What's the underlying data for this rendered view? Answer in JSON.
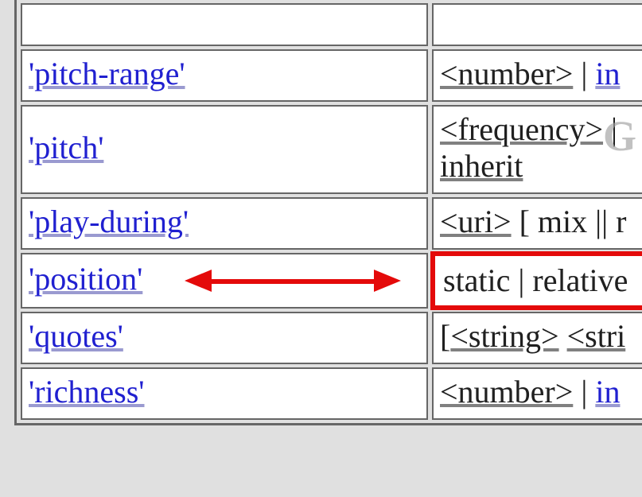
{
  "watermark": "G",
  "rows": [
    {
      "prop": "'pitch-range'",
      "val_parts": [
        {
          "text": "<number>",
          "style": "underlined"
        },
        {
          "text": " | ",
          "style": "plain"
        },
        {
          "text": "in",
          "style": "link-partial"
        }
      ],
      "highlight": false
    },
    {
      "prop": "'pitch'",
      "val_parts": [
        {
          "text": "<frequency>",
          "style": "underlined"
        },
        {
          "text": " |",
          "style": "plain-line1-end"
        },
        {
          "text": "inherit",
          "style": "underlined-line2"
        }
      ],
      "highlight": false,
      "two_lines": true
    },
    {
      "prop": "'play-during'",
      "val_parts": [
        {
          "text": "<uri>",
          "style": "underlined"
        },
        {
          "text": " [ mix || r",
          "style": "plain"
        }
      ],
      "highlight": false
    },
    {
      "prop": "'position'",
      "val_parts": [
        {
          "text": "static | relative",
          "style": "plain-highlight"
        }
      ],
      "highlight": true
    },
    {
      "prop": "'quotes'",
      "val_parts": [
        {
          "text": "[",
          "style": "plain"
        },
        {
          "text": "<string>",
          "style": "underlined"
        },
        {
          "text": " ",
          "style": "plain"
        },
        {
          "text": "<stri",
          "style": "underlined"
        }
      ],
      "highlight": false
    },
    {
      "prop": "'richness'",
      "val_parts": [
        {
          "text": "<number>",
          "style": "underlined"
        },
        {
          "text": " | ",
          "style": "plain"
        },
        {
          "text": "in",
          "style": "link-partial"
        }
      ],
      "highlight": false
    }
  ]
}
